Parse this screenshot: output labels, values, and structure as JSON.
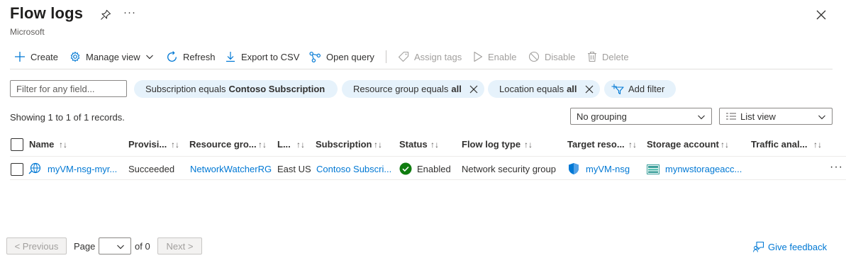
{
  "header": {
    "title": "Flow logs",
    "subtitle": "Microsoft",
    "more_label": "···"
  },
  "toolbar": {
    "create": "Create",
    "manage_view": "Manage view",
    "refresh": "Refresh",
    "export_csv": "Export to CSV",
    "open_query": "Open query",
    "assign_tags": "Assign tags",
    "enable": "Enable",
    "disable": "Disable",
    "delete": "Delete"
  },
  "filters": {
    "placeholder": "Filter for any field...",
    "subscription_prefix": "Subscription equals",
    "subscription_value": "Contoso Subscription",
    "resource_group_prefix": "Resource group equals",
    "resource_group_value": "all",
    "location_prefix": "Location equals",
    "location_value": "all",
    "add_filter": "Add filter"
  },
  "records_text": "Showing 1 to 1 of 1 records.",
  "grouping": "No grouping",
  "view": "List view",
  "table": {
    "columns": {
      "name": "Name",
      "provisioning": "Provisi...",
      "resource_group": "Resource gro...",
      "location": "L...",
      "subscription": "Subscription",
      "status": "Status",
      "flow_log_type": "Flow log type",
      "target_resource": "Target reso...",
      "storage_account": "Storage account",
      "traffic_analytics": "Traffic anal..."
    },
    "rows": [
      {
        "name": "myVM-nsg-myr...",
        "provisioning": "Succeeded",
        "resource_group": "NetworkWatcherRG",
        "location": "East US",
        "subscription": "Contoso Subscri...",
        "status": "Enabled",
        "flow_log_type": "Network security group",
        "target_resource": "myVM-nsg",
        "storage_account": "mynwstorageacc..."
      }
    ]
  },
  "pager": {
    "previous": "< Previous",
    "page_label": "Page",
    "of_label": "of 0",
    "next": "Next >"
  },
  "feedback": "Give feedback",
  "colors": {
    "accent": "#0078d4",
    "pill_bg": "#e6f2fb",
    "success": "#107c10"
  }
}
